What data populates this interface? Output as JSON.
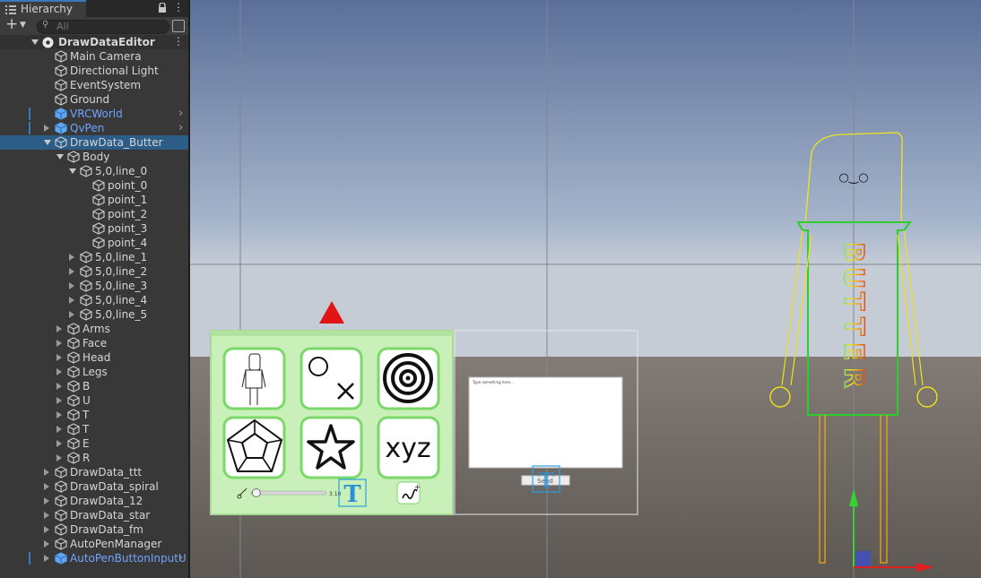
{
  "hierarchy": {
    "tab_title": "Hierarchy",
    "search_placeholder": "All",
    "scene_name": "DrawDataEditor",
    "items": [
      {
        "label": "Main Camera",
        "depth": 1,
        "arrow": "none"
      },
      {
        "label": "Directional Light",
        "depth": 1,
        "arrow": "none"
      },
      {
        "label": "EventSystem",
        "depth": 1,
        "arrow": "none"
      },
      {
        "label": "Ground",
        "depth": 1,
        "arrow": "none"
      },
      {
        "label": "VRCWorld",
        "depth": 1,
        "arrow": "none",
        "prefab": true,
        "chevron": true
      },
      {
        "label": "QvPen",
        "depth": 1,
        "arrow": "right",
        "prefab": true,
        "chevron": true
      },
      {
        "label": "DrawData_Butter",
        "depth": 1,
        "arrow": "down",
        "selected": true
      },
      {
        "label": "Body",
        "depth": 2,
        "arrow": "down"
      },
      {
        "label": "5,0,line_0",
        "depth": 3,
        "arrow": "down"
      },
      {
        "label": "point_0",
        "depth": 4,
        "arrow": "none"
      },
      {
        "label": "point_1",
        "depth": 4,
        "arrow": "none"
      },
      {
        "label": "point_2",
        "depth": 4,
        "arrow": "none"
      },
      {
        "label": "point_3",
        "depth": 4,
        "arrow": "none"
      },
      {
        "label": "point_4",
        "depth": 4,
        "arrow": "none"
      },
      {
        "label": "5,0,line_1",
        "depth": 3,
        "arrow": "right"
      },
      {
        "label": "5,0,line_2",
        "depth": 3,
        "arrow": "right"
      },
      {
        "label": "5,0,line_3",
        "depth": 3,
        "arrow": "right"
      },
      {
        "label": "5,0,line_4",
        "depth": 3,
        "arrow": "right"
      },
      {
        "label": "5,0,line_5",
        "depth": 3,
        "arrow": "right"
      },
      {
        "label": "Arms",
        "depth": 2,
        "arrow": "right"
      },
      {
        "label": "Face",
        "depth": 2,
        "arrow": "right"
      },
      {
        "label": "Head",
        "depth": 2,
        "arrow": "right"
      },
      {
        "label": "Legs",
        "depth": 2,
        "arrow": "right"
      },
      {
        "label": "B",
        "depth": 2,
        "arrow": "right"
      },
      {
        "label": "U",
        "depth": 2,
        "arrow": "right"
      },
      {
        "label": "T",
        "depth": 2,
        "arrow": "right"
      },
      {
        "label": "T",
        "depth": 2,
        "arrow": "right"
      },
      {
        "label": "E",
        "depth": 2,
        "arrow": "right"
      },
      {
        "label": "R",
        "depth": 2,
        "arrow": "right"
      },
      {
        "label": "DrawData_ttt",
        "depth": 1,
        "arrow": "right"
      },
      {
        "label": "DrawData_spiral",
        "depth": 1,
        "arrow": "right"
      },
      {
        "label": "DrawData_12",
        "depth": 1,
        "arrow": "right"
      },
      {
        "label": "DrawData_star",
        "depth": 1,
        "arrow": "right"
      },
      {
        "label": "DrawData_fm",
        "depth": 1,
        "arrow": "right"
      },
      {
        "label": "AutoPenManager",
        "depth": 1,
        "arrow": "right"
      },
      {
        "label": "AutoPenButtonInputU",
        "depth": 1,
        "arrow": "right",
        "prefab": true,
        "chevron": true
      }
    ]
  },
  "scene": {
    "panel": {
      "slider_value": 0.2,
      "slider_text": "3.10",
      "text_button": "T",
      "buttons": [
        "figure-thumbnail",
        "circle-x-thumbnail",
        "target-thumbnail",
        "dodecahedron-thumbnail",
        "star-thumbnail",
        "xyz-thumbnail"
      ],
      "xyz_label": "xyz"
    },
    "preview": {
      "caption": "Type something here...",
      "button_label": "Send",
      "text_button": "T"
    },
    "drawing": {
      "letters": [
        "B",
        "U",
        "T",
        "T",
        "E",
        "R"
      ],
      "face": "○‿○"
    },
    "colors": {
      "accent": "#3a79bb",
      "selection": "#2c5d87",
      "prefab": "#6fa4ff",
      "panel_green": "#c8f0b8",
      "gizmo_red": "#e02020",
      "gizmo_green": "#35d335",
      "gizmo_blue": "#3b4dce"
    }
  }
}
